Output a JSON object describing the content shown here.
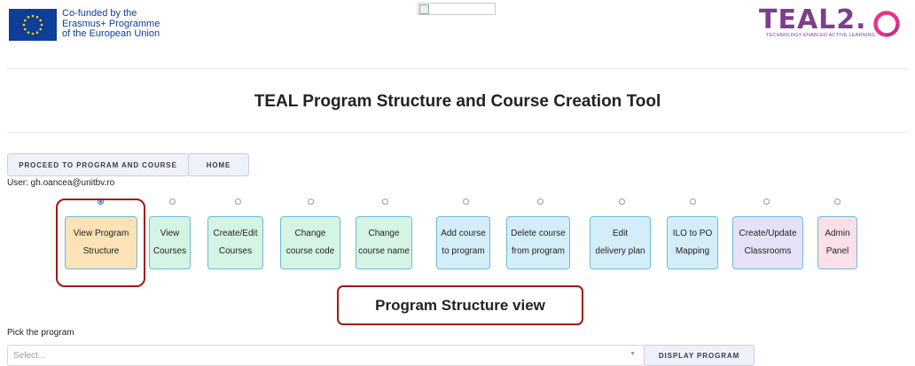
{
  "header": {
    "eu_lines": [
      "Co-funded by the",
      "Erasmus+ Programme",
      "of the European Union"
    ],
    "logo_word": "TEAL2.",
    "logo_tagline": "TECHNOLOGY ENABLED ACTIVE LEARNING",
    "brand_color": "#7b3f8c",
    "eu_color": "#0e3e97"
  },
  "title": "TEAL Program Structure and Course Creation Tool",
  "nav": {
    "proceed_label": "PROCEED TO PROGRAM AND COURSE",
    "home_label": "HOME"
  },
  "user_line": "User: gh.oancea@unitbv.ro",
  "tools": [
    {
      "l1": "View Program",
      "l2": "Structure",
      "color": "orange",
      "selected": true
    },
    {
      "l1": "View",
      "l2": "Courses",
      "color": "green",
      "selected": false
    },
    {
      "l1": "Create/Edit",
      "l2": "Courses",
      "color": "green",
      "selected": false
    },
    {
      "l1": "Change",
      "l2": "course code",
      "color": "green",
      "selected": false
    },
    {
      "l1": "Change",
      "l2": "course name",
      "color": "green",
      "selected": false
    },
    {
      "l1": "Add course",
      "l2": "to program",
      "color": "blue",
      "selected": false
    },
    {
      "l1": "Delete course",
      "l2": "from program",
      "color": "blue",
      "selected": false
    },
    {
      "l1": "Edit",
      "l2": "delivery plan",
      "color": "blue",
      "selected": false
    },
    {
      "l1": "ILO to PO",
      "l2": "Mapping",
      "color": "blue",
      "selected": false
    },
    {
      "l1": "Create/Update",
      "l2": "Classrooms",
      "color": "lavender",
      "selected": false
    },
    {
      "l1": "Admin",
      "l2": "Panel",
      "color": "pink",
      "selected": false
    }
  ],
  "section_title": "Program Structure view",
  "pick_label": "Pick the program",
  "select": {
    "placeholder": "Select...",
    "caret_icon": "chevron-down-icon"
  },
  "display_button": "DISPLAY PROGRAM"
}
